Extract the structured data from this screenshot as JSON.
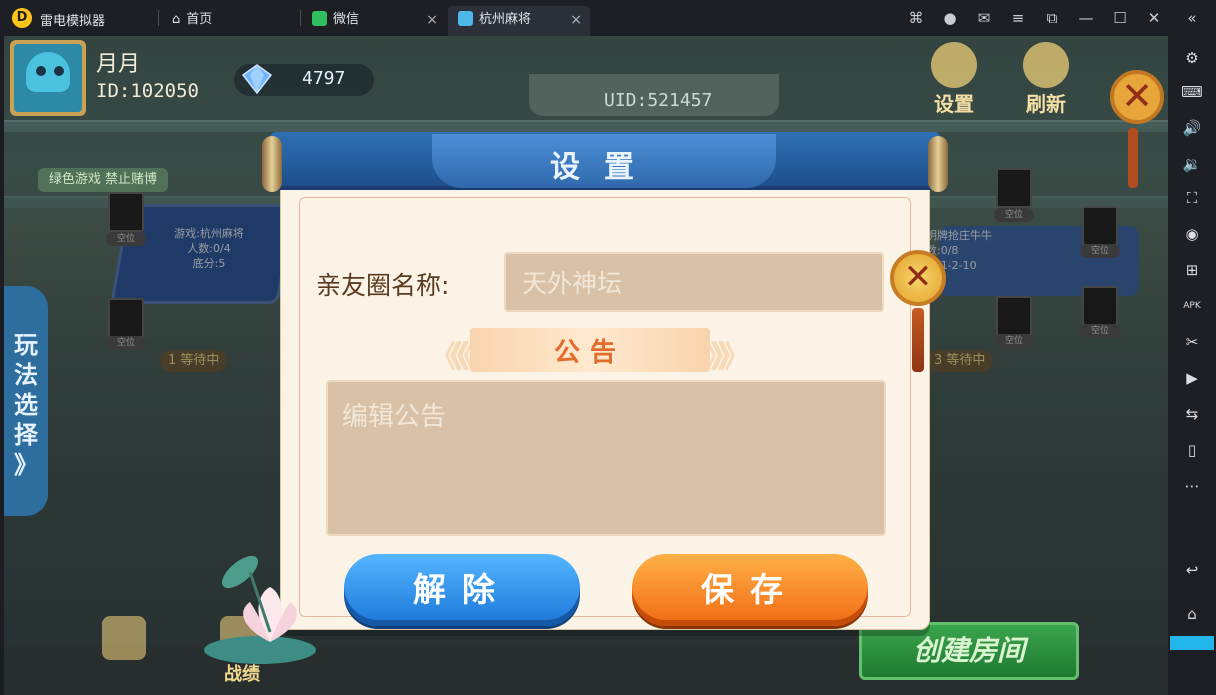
{
  "emulator": {
    "app_name": "雷电模拟器",
    "tabs": [
      {
        "label": "首页",
        "icon": "home-icon"
      },
      {
        "label": "微信",
        "icon": "wechat-icon",
        "close": "×"
      },
      {
        "label": "杭州麻将",
        "icon": "mahjong-app-icon",
        "close": "×"
      }
    ],
    "title_controls": [
      "gamepad-icon",
      "account-icon",
      "mail-icon",
      "menu-icon",
      "window-icon",
      "minimize-icon",
      "maximize-icon",
      "close-icon",
      "collapse-icon"
    ],
    "sidebar_tools": [
      "settings-icon",
      "keyboard-icon",
      "volume-up-icon",
      "volume-down-icon",
      "screenshot-icon",
      "record-icon",
      "add-icon",
      "apk-icon",
      "scissors-icon",
      "play-icon",
      "sync-icon",
      "shake-icon",
      "more-icon",
      "back-icon",
      "home-icon"
    ],
    "apk_label": "APK"
  },
  "game": {
    "player": {
      "name": "月月",
      "id": "ID:102050"
    },
    "gems": "4797",
    "uid": "UID:521457",
    "header_buttons": {
      "settings": "设置",
      "refresh": "刷新"
    },
    "green_notice": "绿色游戏 禁止赌博",
    "mode_tab": [
      "玩",
      "法",
      "选",
      "择",
      "》"
    ],
    "left_table": {
      "line1": "游戏:杭州麻将",
      "line2": "人数:0/4",
      "line3": "底分:5",
      "waiting": "1 等待中"
    },
    "right_table": {
      "line1": "明牌抢庄牛牛",
      "line2": "数:0/8",
      "line3": "分:1-2-10",
      "waiting": "3 等待中"
    },
    "seat_label": "空位",
    "bottom": {
      "record": "战绩",
      "create_room": "创建房间"
    }
  },
  "modal": {
    "title": "设置",
    "name_label": "亲友圈名称:",
    "name_value": "天外神坛",
    "notice_label": "公告",
    "notice_placeholder": "编辑公告",
    "release_button": "解除",
    "save_button": "保存",
    "close_glyph": "✕"
  },
  "colors": {
    "banner_blue": "#2f6fb4",
    "paper": "#fbf3e6",
    "field": "#d8c1a6",
    "blue_button": "#1b76d8",
    "orange_button": "#f06a14",
    "notice_red": "#e36b2c"
  }
}
